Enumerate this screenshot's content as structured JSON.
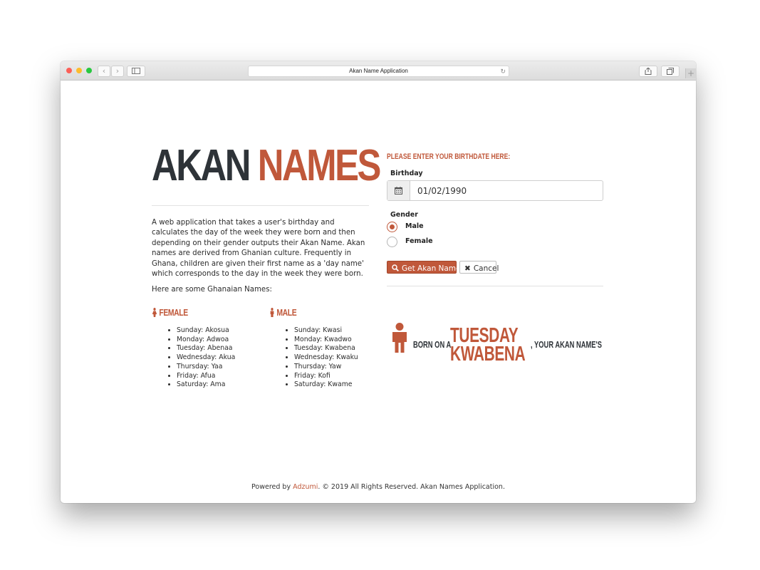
{
  "browser": {
    "url_title": "Akan Name Application",
    "nav_back": "‹",
    "nav_forward": "›",
    "reload": "↻",
    "new_tab": "+"
  },
  "brand": {
    "word1": "AKAN",
    "word2": "NAMES"
  },
  "description": "A web application that takes a user's birthday and calculates the day of the week they were born and then depending on their gender outputs their Akan Name. Akan names are derived from Ghanian culture. Frequently in Ghana, children are given their first name as a 'day name' which corresponds to the day in the week they were born.",
  "names_intro": "Here are some Ghanaian Names:",
  "female": {
    "heading": "FEMALE",
    "names": [
      "Sunday: Akosua",
      "Monday: Adwoa",
      "Tuesday: Abenaa",
      "Wednesday: Akua",
      "Thursday: Yaa",
      "Friday: Afua",
      "Saturday: Ama"
    ]
  },
  "male": {
    "heading": "MALE",
    "names": [
      "Sunday: Kwasi",
      "Monday: Kwadwo",
      "Tuesday: Kwabena",
      "Wednesday: Kwaku",
      "Thursday: Yaw",
      "Friday: Kofi",
      "Saturday: Kwame"
    ]
  },
  "form": {
    "title": "PLEASE ENTER YOUR BIRTHDATE HERE:",
    "birthday_label": "Birthday",
    "birthday_value": "01/02/1990",
    "gender_label": "Gender",
    "gender_options": [
      {
        "label": "Male",
        "checked": true
      },
      {
        "label": "Female",
        "checked": false
      }
    ],
    "submit_label": "Get Akan Name",
    "cancel_label": "Cancel"
  },
  "result": {
    "born_on": "BORN ON A",
    "day": "TUESDAY",
    "your_akan": ", YOUR AKAN NAME'S",
    "name": "KWABENA"
  },
  "footer": {
    "prefix": "Powered by",
    "link": "Adzumi",
    "suffix": ". © 2019 All Rights Reserved. Akan Names Application."
  },
  "colors": {
    "accent": "#c0583a",
    "dark": "#2e3338"
  },
  "icons": [
    "calendar-icon",
    "search-icon",
    "close-icon",
    "female-icon",
    "male-icon",
    "person-icon",
    "share-icon",
    "tabs-icon",
    "sidebar-icon"
  ]
}
